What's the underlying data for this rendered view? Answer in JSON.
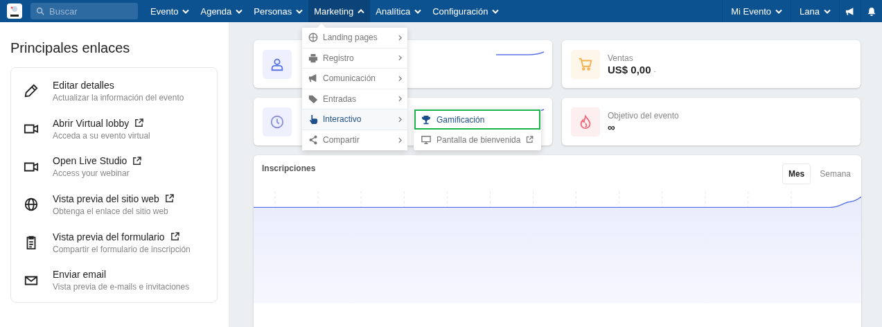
{
  "nav": {
    "search": {
      "placeholder": "Buscar"
    },
    "items": [
      {
        "label": "Evento",
        "expanded": false
      },
      {
        "label": "Agenda",
        "expanded": false
      },
      {
        "label": "Personas",
        "expanded": false
      },
      {
        "label": "Marketing",
        "expanded": true
      },
      {
        "label": "Analítica",
        "expanded": false
      },
      {
        "label": "Configuración",
        "expanded": false
      }
    ],
    "right": [
      {
        "label": "Mi Evento"
      },
      {
        "label": "Lana"
      }
    ]
  },
  "menu": {
    "items": [
      {
        "label": "Landing pages",
        "selected": false
      },
      {
        "label": "Registro",
        "selected": false
      },
      {
        "label": "Comunicación",
        "selected": false
      },
      {
        "label": "Entradas",
        "selected": false
      },
      {
        "label": "Interactivo",
        "selected": true
      },
      {
        "label": "Compartir",
        "selected": false
      }
    ],
    "submenu": [
      {
        "label": "Gamificación",
        "selected": true,
        "external": false
      },
      {
        "label": "Pantalla de bienvenida",
        "selected": false,
        "external": true
      }
    ]
  },
  "sidebar": {
    "title": "Principales enlaces",
    "items": [
      {
        "title": "Editar detalles",
        "subtitle": "Actualizar la información del evento",
        "external": false
      },
      {
        "title": "Abrir Virtual lobby",
        "subtitle": "Acceda a su evento virtual",
        "external": true
      },
      {
        "title": "Open Live Studio",
        "subtitle": "Access your webinar",
        "external": true
      },
      {
        "title": "Vista previa del sitio web",
        "subtitle": "Obtenga el enlace del sitio web",
        "external": true
      },
      {
        "title": "Vista previa del formulario",
        "subtitle": "Compartir el formulario de inscripción",
        "external": true
      },
      {
        "title": "Enviar email",
        "subtitle": "Vista previa de e-mails e invitaciones",
        "external": false
      }
    ]
  },
  "stats": [
    {
      "kind": "trend"
    },
    {
      "label": "Ventas",
      "value": "US$ 0,00",
      "suffix": "-"
    },
    {
      "kind": "trend"
    },
    {
      "label": "Objetivo del evento",
      "value": "∞"
    }
  ],
  "chart": {
    "title": "Inscripciones",
    "toggles": [
      {
        "label": "Mes",
        "selected": true
      },
      {
        "label": "Semana",
        "selected": false
      }
    ]
  }
}
